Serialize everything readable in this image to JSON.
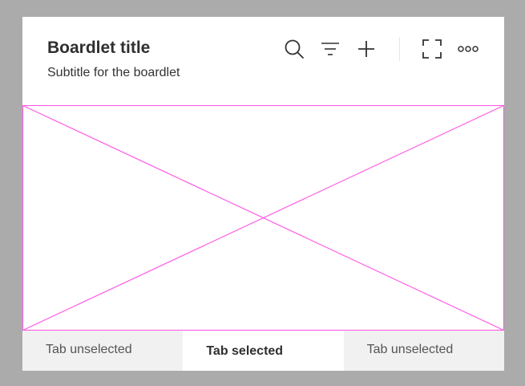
{
  "boardlet": {
    "title": "Boardlet title",
    "subtitle": "Subtitle for the boardlet"
  },
  "toolbar": {
    "icons": [
      "search-icon",
      "filter-icon",
      "add-icon",
      "expand-icon",
      "more-icon"
    ]
  },
  "content": {
    "placeholder": "image-placeholder",
    "accent_color": "#ff5ce6"
  },
  "tabs": [
    {
      "label": "Tab unselected",
      "selected": false
    },
    {
      "label": "Tab selected",
      "selected": true
    },
    {
      "label": "Tab unselected",
      "selected": false
    }
  ]
}
